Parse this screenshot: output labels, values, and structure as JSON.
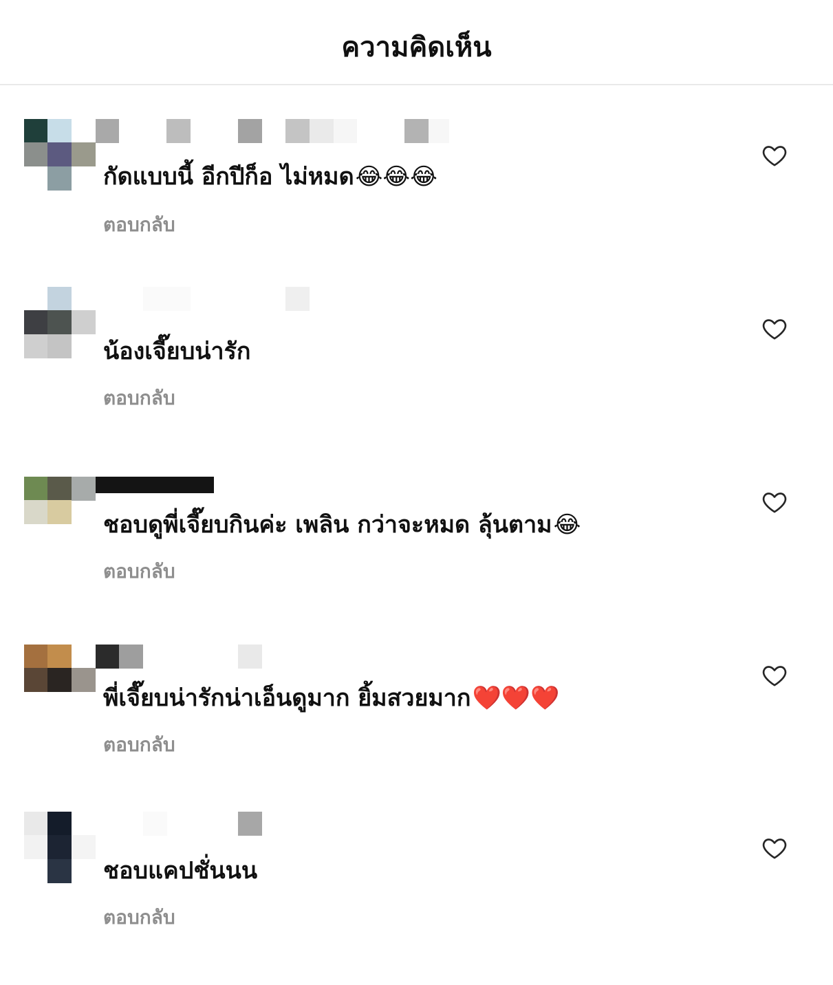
{
  "header": {
    "title": "ความคิดเห็น"
  },
  "comments": [
    {
      "text": "กัดแบบนี้ อีกปีก็อ ไม่หมด",
      "emoji": "😂😂😂",
      "reply_label": "ตอบกลับ"
    },
    {
      "text": "น้องเจี๊ยบน่ารัก",
      "emoji": "",
      "reply_label": "ตอบกลับ"
    },
    {
      "text": "ชอบดูพี่เจี๊ยบกินค่ะ เพลิน กว่าจะหมด ลุ้นตาม",
      "emoji": "😂",
      "reply_label": "ตอบกลับ"
    },
    {
      "text": "พี่เจี๊ยบน่ารักน่าเอ็นดูมาก ยิ้มสวยมาก",
      "emoji": "❤️❤️❤️",
      "reply_label": "ตอบกลับ"
    },
    {
      "text": "ชอบแคปชั่นนน",
      "emoji": "",
      "reply_label": "ตอบกลับ"
    }
  ],
  "icons": {
    "like": "heart-outline-icon"
  },
  "colors": {
    "reply_text": "#8e8e8e",
    "divider": "#e9e9e9",
    "heart_stroke": "#262626"
  }
}
